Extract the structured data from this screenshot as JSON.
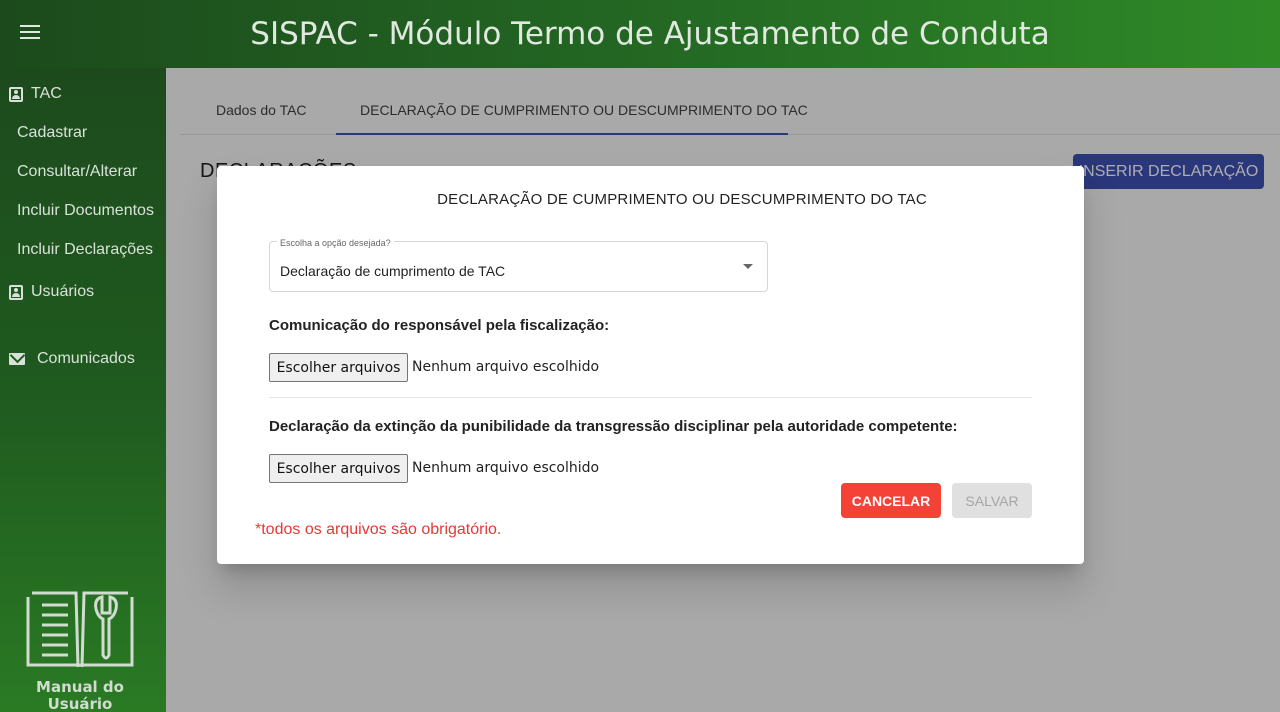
{
  "header": {
    "title": "SISPAC - Módulo Termo de Ajustamento de Conduta"
  },
  "sidebar": {
    "section_tac": "TAC",
    "items": [
      "Cadastrar",
      "Consultar/Alterar",
      "Incluir Documentos",
      "Incluir Declarações"
    ],
    "section_users": "Usuários",
    "section_notices": "Comunicados",
    "manual_line1": "Manual do",
    "manual_line2": "Usuário"
  },
  "main": {
    "tabs": [
      {
        "label": "Dados do TAC"
      },
      {
        "label": "DECLARAÇÃO DE CUMPRIMENTO OU DESCUMPRIMENTO DO TAC",
        "active": true
      }
    ],
    "section_title": "DECLARAÇÕES",
    "insert_button": "INSERIR DECLARAÇÃO"
  },
  "dialog": {
    "title": "DECLARAÇÃO DE CUMPRIMENTO OU DESCUMPRIMENTO DO TAC",
    "select_label": "Escolha a opção desejada?",
    "select_value": "Declaração de cumprimento de TAC",
    "field1_label": "Comunicação do responsável pela fiscalização:",
    "field2_label": "Declaração da extinção da punibilidade da transgressão disciplinar pela autoridade competente:",
    "file_button": "Escolher arquivos",
    "file_status": "Nenhum arquivo escolhido",
    "note": "*todos os arquivos são obrigatório.",
    "cancel": "CANCELAR",
    "save": "SALVAR"
  },
  "colors": {
    "primary": "#3f51b5",
    "danger": "#f44336",
    "header_green": "#246a24"
  }
}
